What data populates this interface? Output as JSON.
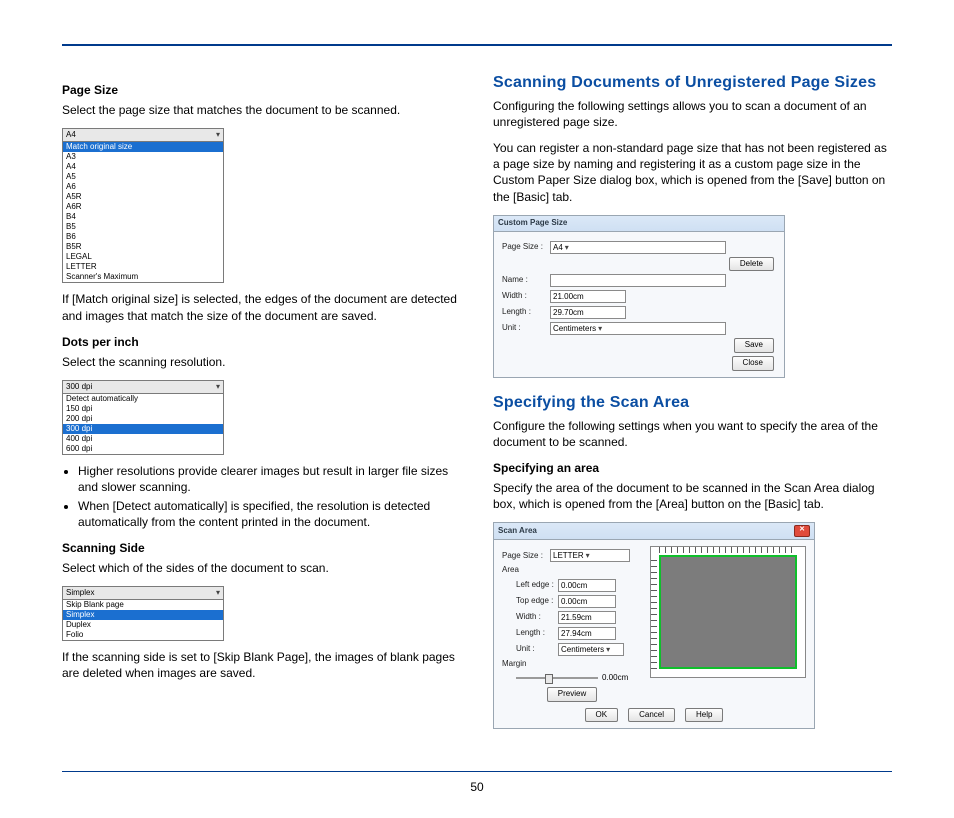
{
  "page": {
    "number": "50"
  },
  "left": {
    "pageSize": {
      "heading": "Page Size",
      "lead": "Select the page size that matches the document to be scanned.",
      "dropdown": {
        "selected": "A4",
        "options": [
          "Match original size",
          "A3",
          "A4",
          "A5",
          "A6",
          "A5R",
          "A6R",
          "B4",
          "B5",
          "B6",
          "B5R",
          "LEGAL",
          "LETTER",
          "Scanner's Maximum"
        ],
        "highlight_index": 0
      },
      "after": "If [Match original size] is selected, the edges of the document are detected and images that match the size of the document are saved."
    },
    "dpi": {
      "heading": "Dots per inch",
      "lead": "Select the scanning resolution.",
      "dropdown": {
        "selected": "300 dpi",
        "options": [
          "Detect automatically",
          "150 dpi",
          "200 dpi",
          "300 dpi",
          "400 dpi",
          "600 dpi"
        ],
        "highlight_index": 3
      },
      "bullets": [
        "Higher resolutions provide clearer images but result in larger file sizes and slower scanning.",
        "When [Detect automatically] is specified, the resolution is detected automatically from the content printed in the document."
      ]
    },
    "side": {
      "heading": "Scanning Side",
      "lead": "Select which of the sides of the document to scan.",
      "dropdown": {
        "selected": "Simplex",
        "options": [
          "Skip Blank page",
          "Simplex",
          "Duplex",
          "Folio"
        ],
        "highlight_index": 1
      },
      "after": "If the scanning side is set to [Skip Blank Page], the images of blank pages are deleted when images are saved."
    }
  },
  "right": {
    "unreg": {
      "heading": "Scanning Documents of Unregistered Page Sizes",
      "p1": "Configuring the following settings allows you to scan a document of an unregistered page size.",
      "p2": "You can register a non-standard page size that has not been registered as a page size by naming and registering it as a custom page size in the Custom Paper Size dialog box, which is opened from the [Save] button on the [Basic] tab.",
      "dialog": {
        "title": "Custom Page Size",
        "fields": {
          "pagesize_lab": "Page Size :",
          "pagesize": "A4",
          "name_lab": "Name :",
          "name": "",
          "width_lab": "Width :",
          "width": "21.00cm",
          "length_lab": "Length :",
          "length": "29.70cm",
          "unit_lab": "Unit :",
          "unit": "Centimeters"
        },
        "buttons": {
          "delete": "Delete",
          "save": "Save",
          "close": "Close"
        }
      }
    },
    "area": {
      "heading": "Specifying the Scan Area",
      "lead": "Configure the following settings when you want to specify the area of the document to be scanned.",
      "sub": "Specifying an area",
      "p": "Specify the area of the document to be scanned in the Scan Area dialog box, which is opened from the [Area] button on the [Basic] tab.",
      "dialog": {
        "title": "Scan Area",
        "fields": {
          "pagesize_lab": "Page Size :",
          "pagesize": "LETTER",
          "area_lab": "Area",
          "left_lab": "Left edge :",
          "left": "0.00cm",
          "top_lab": "Top edge :",
          "top": "0.00cm",
          "width_lab": "Width :",
          "width": "21.59cm",
          "length_lab": "Length :",
          "length": "27.94cm",
          "unit_lab": "Unit :",
          "unit": "Centimeters",
          "margin_lab": "Margin",
          "margin": "0.00cm"
        },
        "buttons": {
          "preview": "Preview",
          "ok": "OK",
          "cancel": "Cancel",
          "help": "Help"
        }
      }
    }
  }
}
